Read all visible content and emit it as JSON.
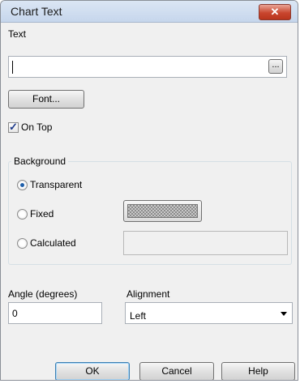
{
  "window": {
    "title": "Chart Text",
    "close_glyph": "✕"
  },
  "text_field": {
    "label": "Text",
    "value": "",
    "browse_label": "..."
  },
  "font_button": {
    "label": "Font..."
  },
  "on_top": {
    "label": "On Top",
    "checked": true
  },
  "background": {
    "legend": "Background",
    "options": [
      {
        "label": "Transparent",
        "selected": true
      },
      {
        "label": "Fixed",
        "selected": false
      },
      {
        "label": "Calculated",
        "selected": false
      }
    ]
  },
  "angle": {
    "label": "Angle (degrees)",
    "value": "0"
  },
  "alignment": {
    "label": "Alignment",
    "value": "Left"
  },
  "buttons": {
    "ok": "OK",
    "cancel": "Cancel",
    "help": "Help"
  }
}
